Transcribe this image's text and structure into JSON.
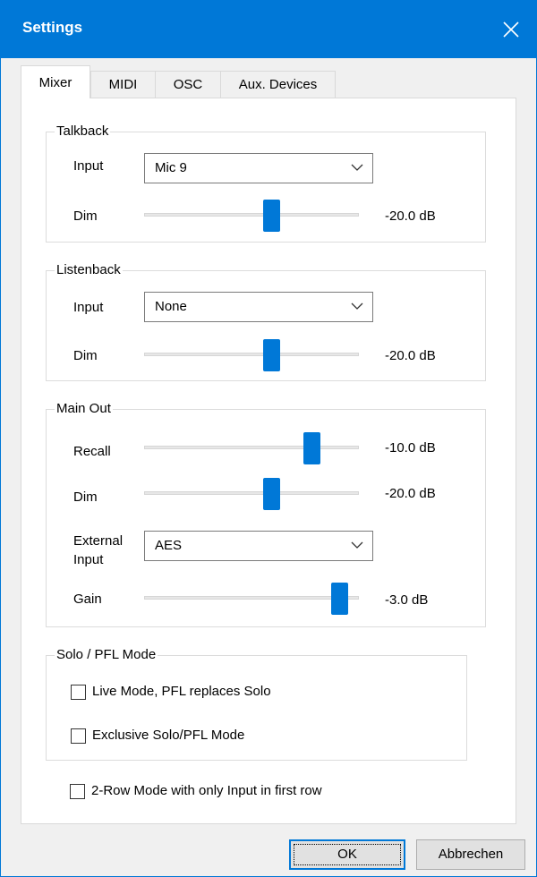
{
  "window": {
    "title": "Settings"
  },
  "tabs": [
    {
      "label": "Mixer",
      "active": true
    },
    {
      "label": "MIDI",
      "active": false
    },
    {
      "label": "OSC",
      "active": false
    },
    {
      "label": "Aux. Devices",
      "active": false
    }
  ],
  "talkback": {
    "title": "Talkback",
    "input_label": "Input",
    "input_value": "Mic 9",
    "dim_label": "Dim",
    "dim_value": "-20.0 dB",
    "dim_position": 0.59
  },
  "listenback": {
    "title": "Listenback",
    "input_label": "Input",
    "input_value": "None",
    "dim_label": "Dim",
    "dim_value": "-20.0 dB",
    "dim_position": 0.59
  },
  "main_out": {
    "title": "Main Out",
    "recall_label": "Recall",
    "recall_value": "-10.0 dB",
    "recall_position": 0.78,
    "dim_label": "Dim",
    "dim_value": "-20.0 dB",
    "dim_position": 0.59,
    "external_input_label_line1": "External",
    "external_input_label_line2": "Input",
    "external_input_value": "AES",
    "gain_label": "Gain",
    "gain_value": "-3.0 dB",
    "gain_position": 0.91
  },
  "solo_pfl": {
    "title": "Solo / PFL Mode",
    "live_mode_label": "Live Mode,  PFL replaces Solo",
    "live_mode_checked": false,
    "exclusive_label": "Exclusive Solo/PFL Mode",
    "exclusive_checked": false
  },
  "two_row_mode": {
    "label": "2-Row Mode with only Input in first row",
    "checked": false
  },
  "buttons": {
    "ok": "OK",
    "cancel": "Abbrechen"
  },
  "colors": {
    "accent": "#0078d7",
    "panel": "#ffffff",
    "dialog_bg": "#f0f0f0"
  }
}
